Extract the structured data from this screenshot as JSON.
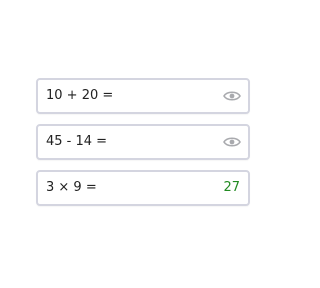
{
  "colors": {
    "card_border": "#d4d5e0",
    "eye_icon": "#a9aaae",
    "answer_correct": "#228b22",
    "text": "#222222"
  },
  "problems": [
    {
      "equation": "10 + 20 =",
      "answer": "",
      "answer_state": "hidden",
      "icon": "eye-icon"
    },
    {
      "equation": "45 - 14 =",
      "answer": "",
      "answer_state": "hidden",
      "icon": "eye-icon"
    },
    {
      "equation": "3 × 9 =",
      "answer": "27",
      "answer_state": "revealed",
      "icon": ""
    }
  ]
}
